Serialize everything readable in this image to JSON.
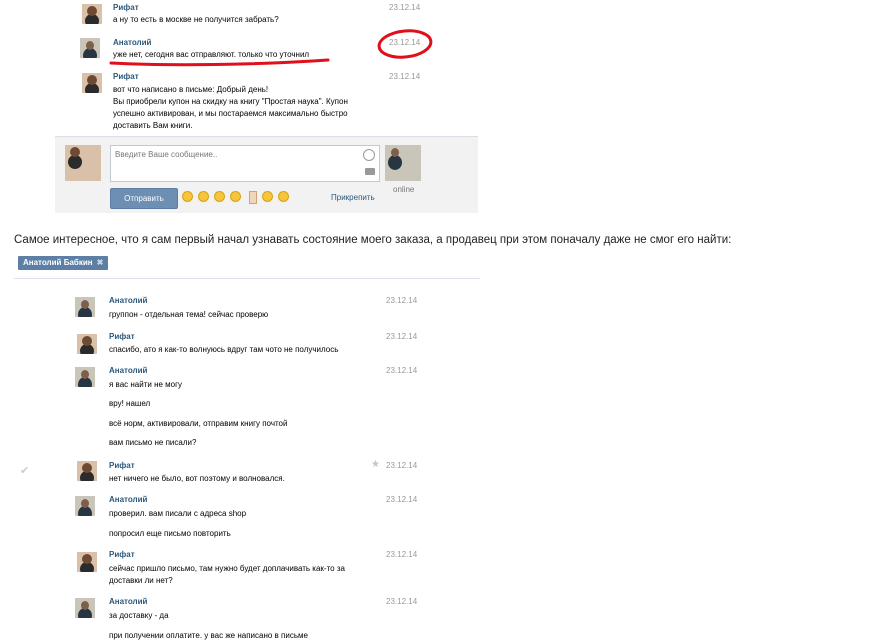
{
  "top_chat": {
    "messages": [
      {
        "author": "Рифат",
        "date": "23.12.14",
        "lines": [
          "а ну то есть в москве не получится забрать?"
        ]
      },
      {
        "author": "Анатолий",
        "date": "23.12.14",
        "lines": [
          "уже нет, сегодня вас отправляют. только что уточнил"
        ]
      },
      {
        "author": "Рифат",
        "date": "23.12.14",
        "lines": [
          "вот что написано в письме: Добрый день!",
          "Вы приобрели купон на скидку на книгу \"Простая наука\". Купон",
          "успешно активирован, и мы постараемся максимально быстро",
          "доставить Вам книги."
        ]
      }
    ],
    "composer": {
      "placeholder": "Введите Ваше сообщение..",
      "send_label": "Отправить",
      "attach_label": "Прикрепить",
      "status": "online"
    }
  },
  "caption": "Самое интересное, что я сам первый начал узнавать состояние моего заказа, а продавец при этом поначалу даже не смог его найти:",
  "tag": {
    "label": "Анатолий Бабкин",
    "close": "✖"
  },
  "bottom_chat": {
    "messages": [
      {
        "author": "Анатолий",
        "date": "23.12.14",
        "lines": [
          "группон - отдельная тема! сейчас проверю"
        ]
      },
      {
        "author": "Рифат",
        "date": "23.12.14",
        "lines": [
          "спасибо, ато я как-то волнуюсь вдруг там чото не получилось"
        ]
      },
      {
        "author": "Анатолий",
        "date": "23.12.14",
        "lines": [
          "я вас найти не могу",
          "вру! нашел",
          "всё норм, активировали, отправим книгу почтой",
          "вам письмо не писали?"
        ]
      },
      {
        "author": "Рифат",
        "date": "23.12.14",
        "lines": [
          "нет ничего не было, вот поэтому и волновался."
        ]
      },
      {
        "author": "Анатолий",
        "date": "23.12.14",
        "lines": [
          "проверил. вам писали с адреса shop",
          "попросил еще письмо повторить"
        ]
      },
      {
        "author": "Рифат",
        "date": "23.12.14",
        "lines": [
          "сейчас пришло письмо, там нужно будет доплачивать как-то за",
          "доставки ли нет?"
        ]
      },
      {
        "author": "Анатолий",
        "date": "23.12.14",
        "lines": [
          "за доставку - да",
          "при получении оплатите. у вас же написано в письме"
        ]
      }
    ]
  },
  "colors": {
    "link": "#2b587a",
    "highlight": "#e0101a",
    "button": "#6d8fb3"
  }
}
